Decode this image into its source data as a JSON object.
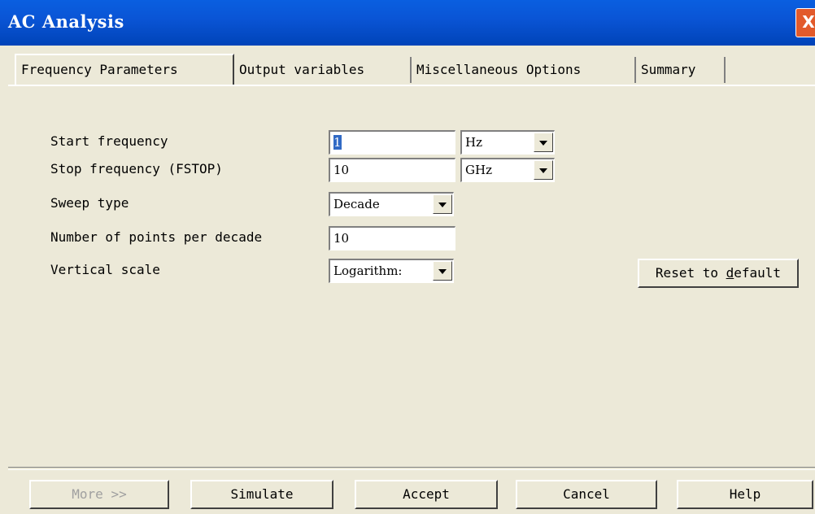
{
  "window": {
    "title": "AC Analysis",
    "close_glyph": "X"
  },
  "tabs": [
    {
      "label": "Frequency Parameters"
    },
    {
      "label": "Output variables"
    },
    {
      "label": "Miscellaneous Options"
    },
    {
      "label": "Summary"
    }
  ],
  "form": {
    "start_frequency": {
      "label": "Start frequency",
      "value": "1",
      "unit": "Hz"
    },
    "stop_frequency": {
      "label": "Stop frequency (FSTOP)",
      "value": "10",
      "unit": "GHz"
    },
    "sweep_type": {
      "label": "Sweep type",
      "value": "Decade"
    },
    "points_per_decade": {
      "label": "Number of points per decade",
      "value": "10"
    },
    "vertical_scale": {
      "label": "Vertical scale",
      "value": "Logarithm:"
    }
  },
  "buttons": {
    "reset_prefix": "Reset to ",
    "reset_underlined": "d",
    "reset_suffix": "efault",
    "more": "More >>",
    "simulate": "Simulate",
    "accept": "Accept",
    "cancel": "Cancel",
    "help": "Help"
  },
  "colors": {
    "titlebar": "#0a55d6",
    "dialog_bg": "#ece9d8",
    "selection": "#316ac5",
    "close_button": "#e25a2b"
  },
  "icons": {
    "close": "close-icon",
    "dropdown": "chevron-down-icon"
  }
}
